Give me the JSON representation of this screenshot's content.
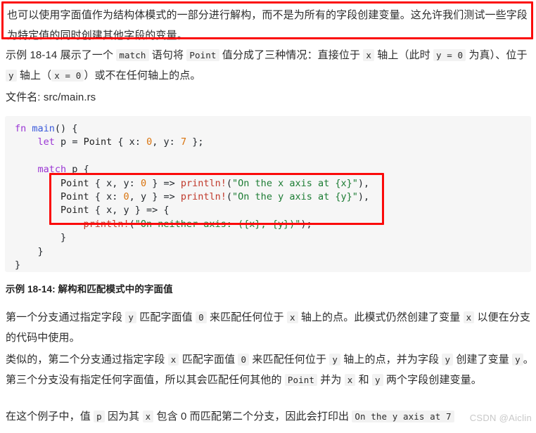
{
  "document": {
    "language": "zh-CN",
    "watermark": "CSDN @Aiclin",
    "accent_red": "#fb0a0a",
    "code_background": "#f6f6f6",
    "inline_code_background": "#f2f2f2"
  },
  "paragraphs": {
    "intro": {
      "text": "也可以使用字面值作为结构体模式的一部分进行解构，而不是为所有的字段创建变量。这允许我们测试一些字段为特定值的同时创建其他字段的变量。",
      "highlighted": true
    },
    "example_intro": {
      "segments": [
        {
          "type": "text",
          "value": "示例 18-14 展示了一个 "
        },
        {
          "type": "code",
          "value": "match"
        },
        {
          "type": "text",
          "value": " 语句将 "
        },
        {
          "type": "code",
          "value": "Point"
        },
        {
          "type": "text",
          "value": " 值分成了三种情况：直接位于 "
        },
        {
          "type": "code",
          "value": "x"
        },
        {
          "type": "text",
          "value": " 轴上（此时 "
        },
        {
          "type": "code",
          "value": "y = 0"
        },
        {
          "type": "text",
          "value": " 为真）、位于 "
        },
        {
          "type": "code",
          "value": "y"
        },
        {
          "type": "text",
          "value": " 轴上（"
        },
        {
          "type": "code",
          "value": "x = 0"
        },
        {
          "type": "text",
          "value": "）或不在任何轴上的点。"
        }
      ]
    },
    "filename": {
      "label": "文件名: ",
      "value": "src/main.rs"
    },
    "branch_first": {
      "segments": [
        {
          "type": "text",
          "value": "第一个分支通过指定字段 "
        },
        {
          "type": "code",
          "value": "y"
        },
        {
          "type": "text",
          "value": " 匹配字面值 "
        },
        {
          "type": "code",
          "value": "0"
        },
        {
          "type": "text",
          "value": " 来匹配任何位于 "
        },
        {
          "type": "code",
          "value": "x"
        },
        {
          "type": "text",
          "value": " 轴上的点。此模式仍然创建了变量 "
        },
        {
          "type": "code",
          "value": "x"
        },
        {
          "type": "text",
          "value": " 以便在分支的代码中使用。"
        }
      ]
    },
    "branch_second": {
      "segments": [
        {
          "type": "text",
          "value": "类似的，第二个分支通过指定字段 "
        },
        {
          "type": "code",
          "value": "x"
        },
        {
          "type": "text",
          "value": " 匹配字面值 "
        },
        {
          "type": "code",
          "value": "0"
        },
        {
          "type": "text",
          "value": " 来匹配任何位于 "
        },
        {
          "type": "code",
          "value": "y"
        },
        {
          "type": "text",
          "value": " 轴上的点，并为字段 "
        },
        {
          "type": "code",
          "value": "y"
        },
        {
          "type": "text",
          "value": " 创建了变量 "
        },
        {
          "type": "code",
          "value": "y"
        },
        {
          "type": "text",
          "value": "。第三个分支没有指定任何字面值，所以其会匹配任何其他的 "
        },
        {
          "type": "code",
          "value": "Point"
        },
        {
          "type": "text",
          "value": " 并为 "
        },
        {
          "type": "code",
          "value": "x"
        },
        {
          "type": "text",
          "value": " 和 "
        },
        {
          "type": "code",
          "value": "y"
        },
        {
          "type": "text",
          "value": " 两个字段创建变量。"
        }
      ]
    },
    "result": {
      "segments": [
        {
          "type": "text",
          "value": "在这个例子中，值 "
        },
        {
          "type": "code",
          "value": "p"
        },
        {
          "type": "text",
          "value": " 因为其 "
        },
        {
          "type": "code",
          "value": "x"
        },
        {
          "type": "text",
          "value": " 包含 0 而匹配第二个分支，因此会打印出 "
        },
        {
          "type": "code",
          "value": "On the y axis at 7"
        }
      ]
    }
  },
  "caption": {
    "text": "示例 18-14: 解构和匹配模式中的字面值"
  },
  "code_block": {
    "language": "rust",
    "filename": "src/main.rs",
    "highlight_region": "match arms",
    "lines": [
      "fn main() {",
      "    let p = Point { x: 0, y: 7 };",
      "",
      "    match p {",
      "        Point { x, y: 0 } => println!(\"On the x axis at {x}\"),",
      "        Point { x: 0, y } => println!(\"On the y axis at {y}\"),",
      "        Point { x, y } => {",
      "            println!(\"On neither axis: ({x}, {y})\");",
      "        }",
      "    }",
      "}"
    ]
  }
}
